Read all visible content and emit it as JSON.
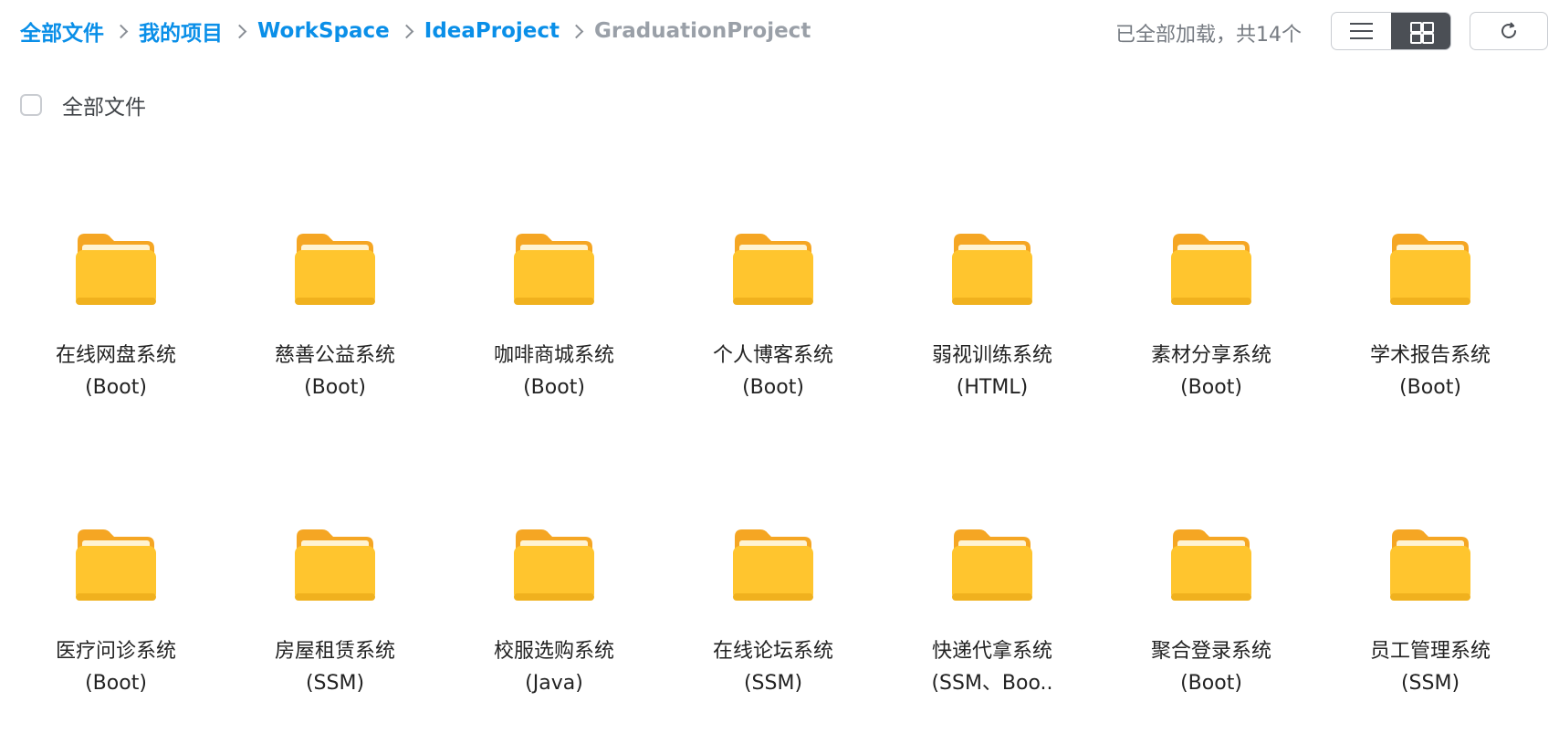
{
  "breadcrumb": [
    "全部文件",
    "我的项目",
    "WorkSpace",
    "IdeaProject",
    "GraduationProject"
  ],
  "status": "已全部加载，共14个",
  "view_modes": {
    "list": "list-view-icon",
    "grid": "grid-view-icon",
    "active": "grid"
  },
  "refresh": "refresh-icon",
  "select_all_label": "全部文件",
  "folder_color": "#ffc52e",
  "files": [
    {
      "name": "在线网盘系统",
      "tag": "(Boot)"
    },
    {
      "name": "慈善公益系统",
      "tag": "(Boot)"
    },
    {
      "name": "咖啡商城系统",
      "tag": "(Boot)"
    },
    {
      "name": "个人博客系统",
      "tag": "(Boot)"
    },
    {
      "name": "弱视训练系统",
      "tag": "(HTML)"
    },
    {
      "name": "素材分享系统",
      "tag": "(Boot)"
    },
    {
      "name": "学术报告系统",
      "tag": "(Boot)"
    },
    {
      "name": "医疗问诊系统",
      "tag": "(Boot)"
    },
    {
      "name": "房屋租赁系统",
      "tag": "(SSM)"
    },
    {
      "name": "校服选购系统",
      "tag": "(Java)"
    },
    {
      "name": "在线论坛系统",
      "tag": "(SSM)"
    },
    {
      "name": "快递代拿系统",
      "tag": "(SSM、Boo.."
    },
    {
      "name": "聚合登录系统",
      "tag": "(Boot)"
    },
    {
      "name": "员工管理系统",
      "tag": "(SSM)"
    }
  ]
}
